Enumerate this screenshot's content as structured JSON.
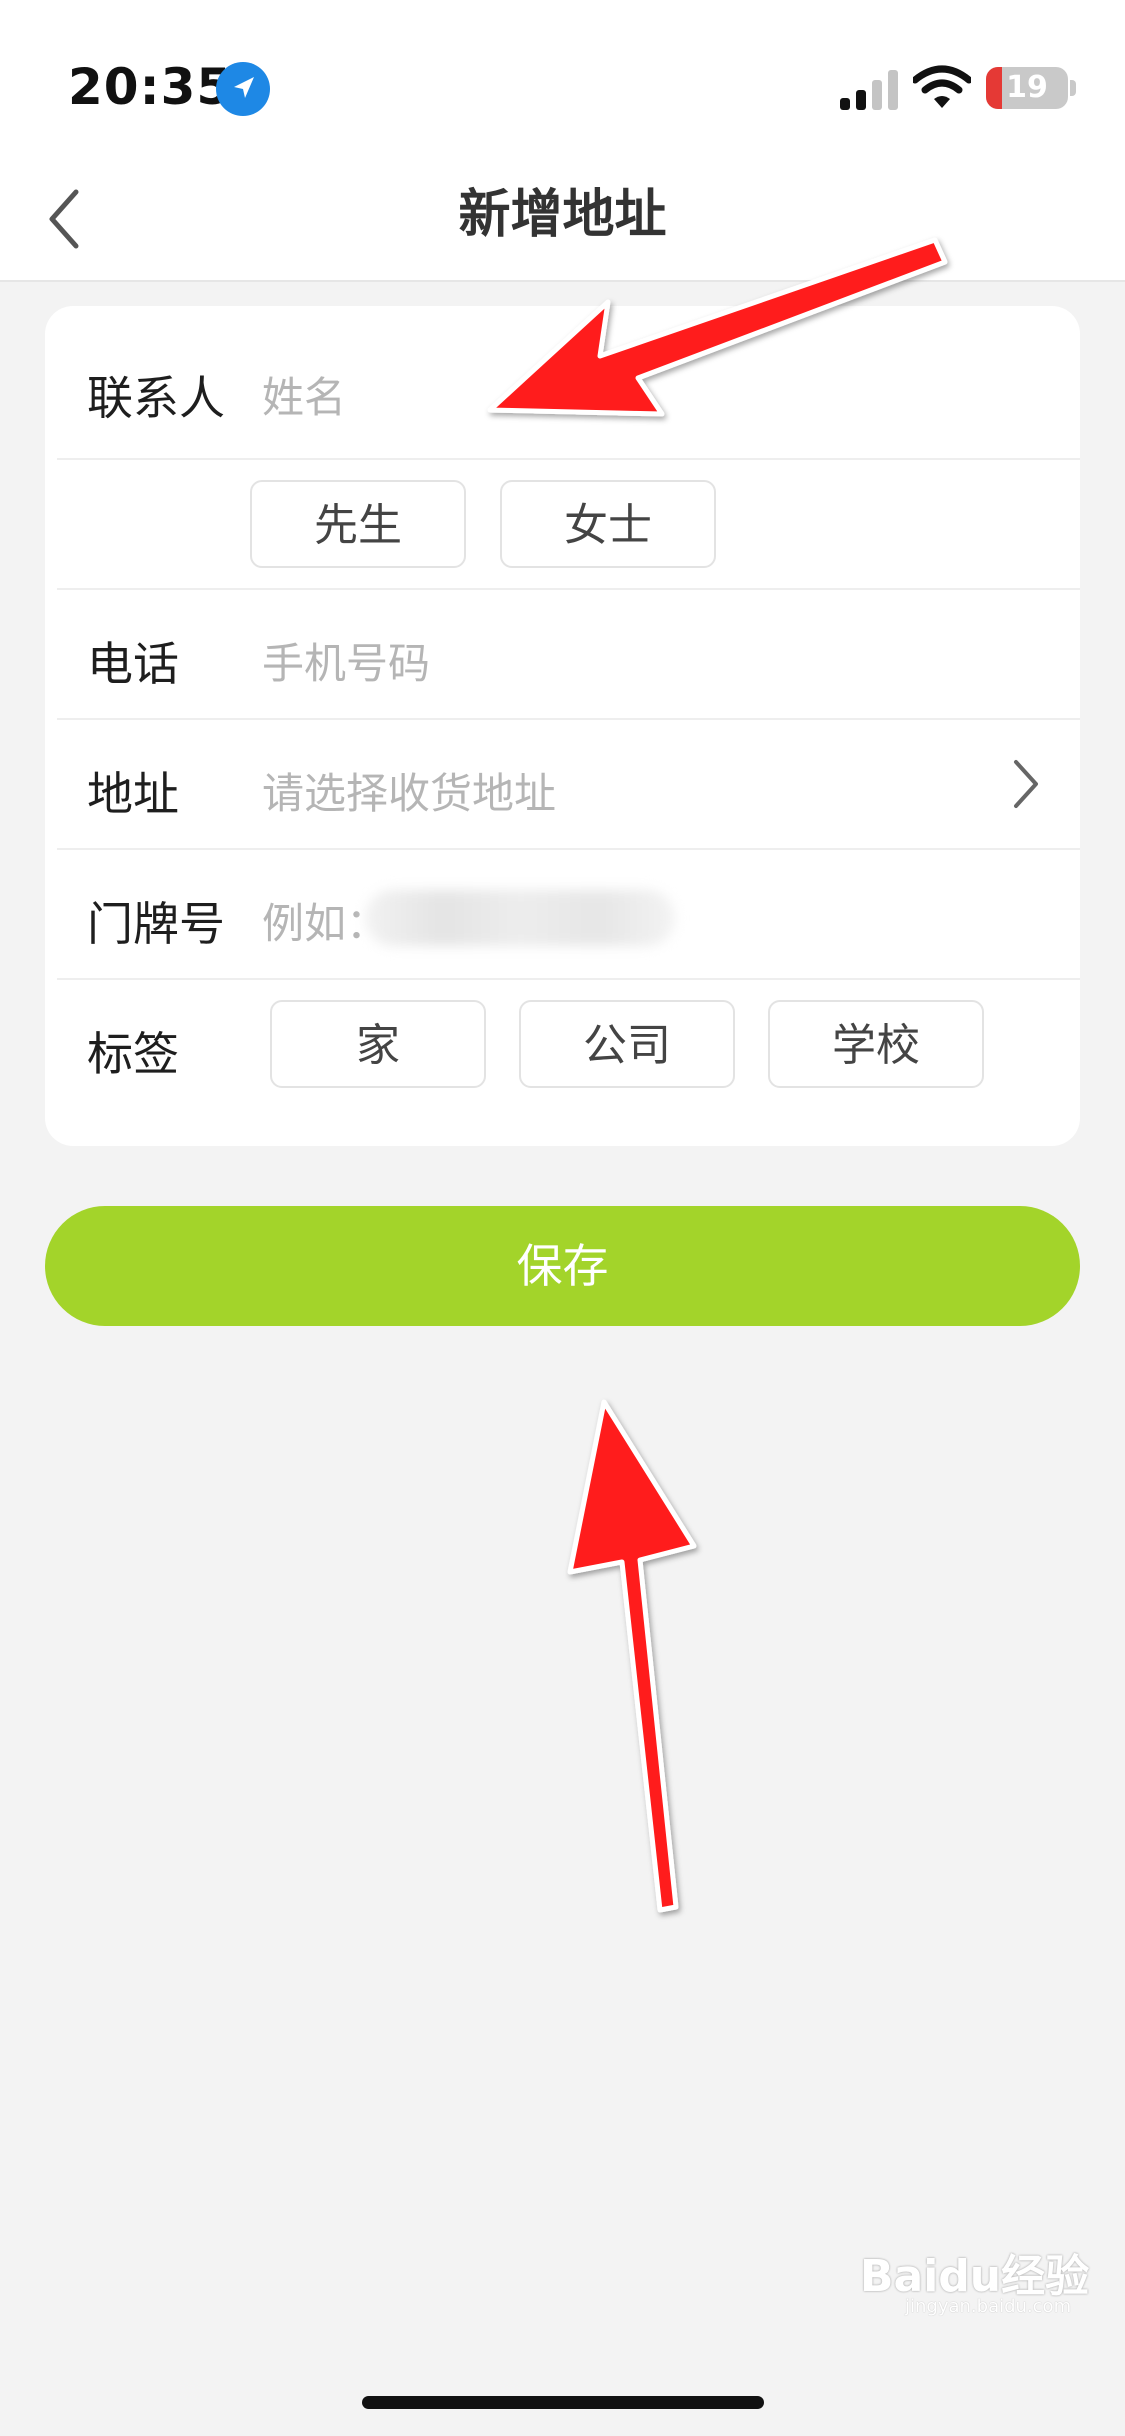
{
  "status_bar": {
    "time": "20:35",
    "battery": "19",
    "battery_percent": 19
  },
  "nav": {
    "title": "新增地址"
  },
  "form": {
    "contact": {
      "label": "联系人",
      "placeholder": "姓名"
    },
    "gender_options": [
      "先生",
      "女士"
    ],
    "phone": {
      "label": "电话",
      "placeholder": "手机号码"
    },
    "address": {
      "label": "地址",
      "placeholder": "请选择收货地址"
    },
    "house_number": {
      "label": "门牌号",
      "placeholder": "例如："
    },
    "tags": {
      "label": "标签",
      "options": [
        "家",
        "公司",
        "学校"
      ]
    }
  },
  "actions": {
    "save_label": "保存"
  },
  "watermark": {
    "main": "Baidu经验",
    "sub": "jingyan.baidu.com"
  },
  "colors": {
    "accent": "#a3d42a",
    "arrow": "#ff1a1a",
    "battery_low": "#e53935",
    "location": "#1e88e5"
  },
  "icons": [
    "location-arrow-icon",
    "cellular-signal-icon",
    "wifi-icon",
    "battery-icon",
    "back-chevron-icon",
    "chevron-right-icon"
  ]
}
